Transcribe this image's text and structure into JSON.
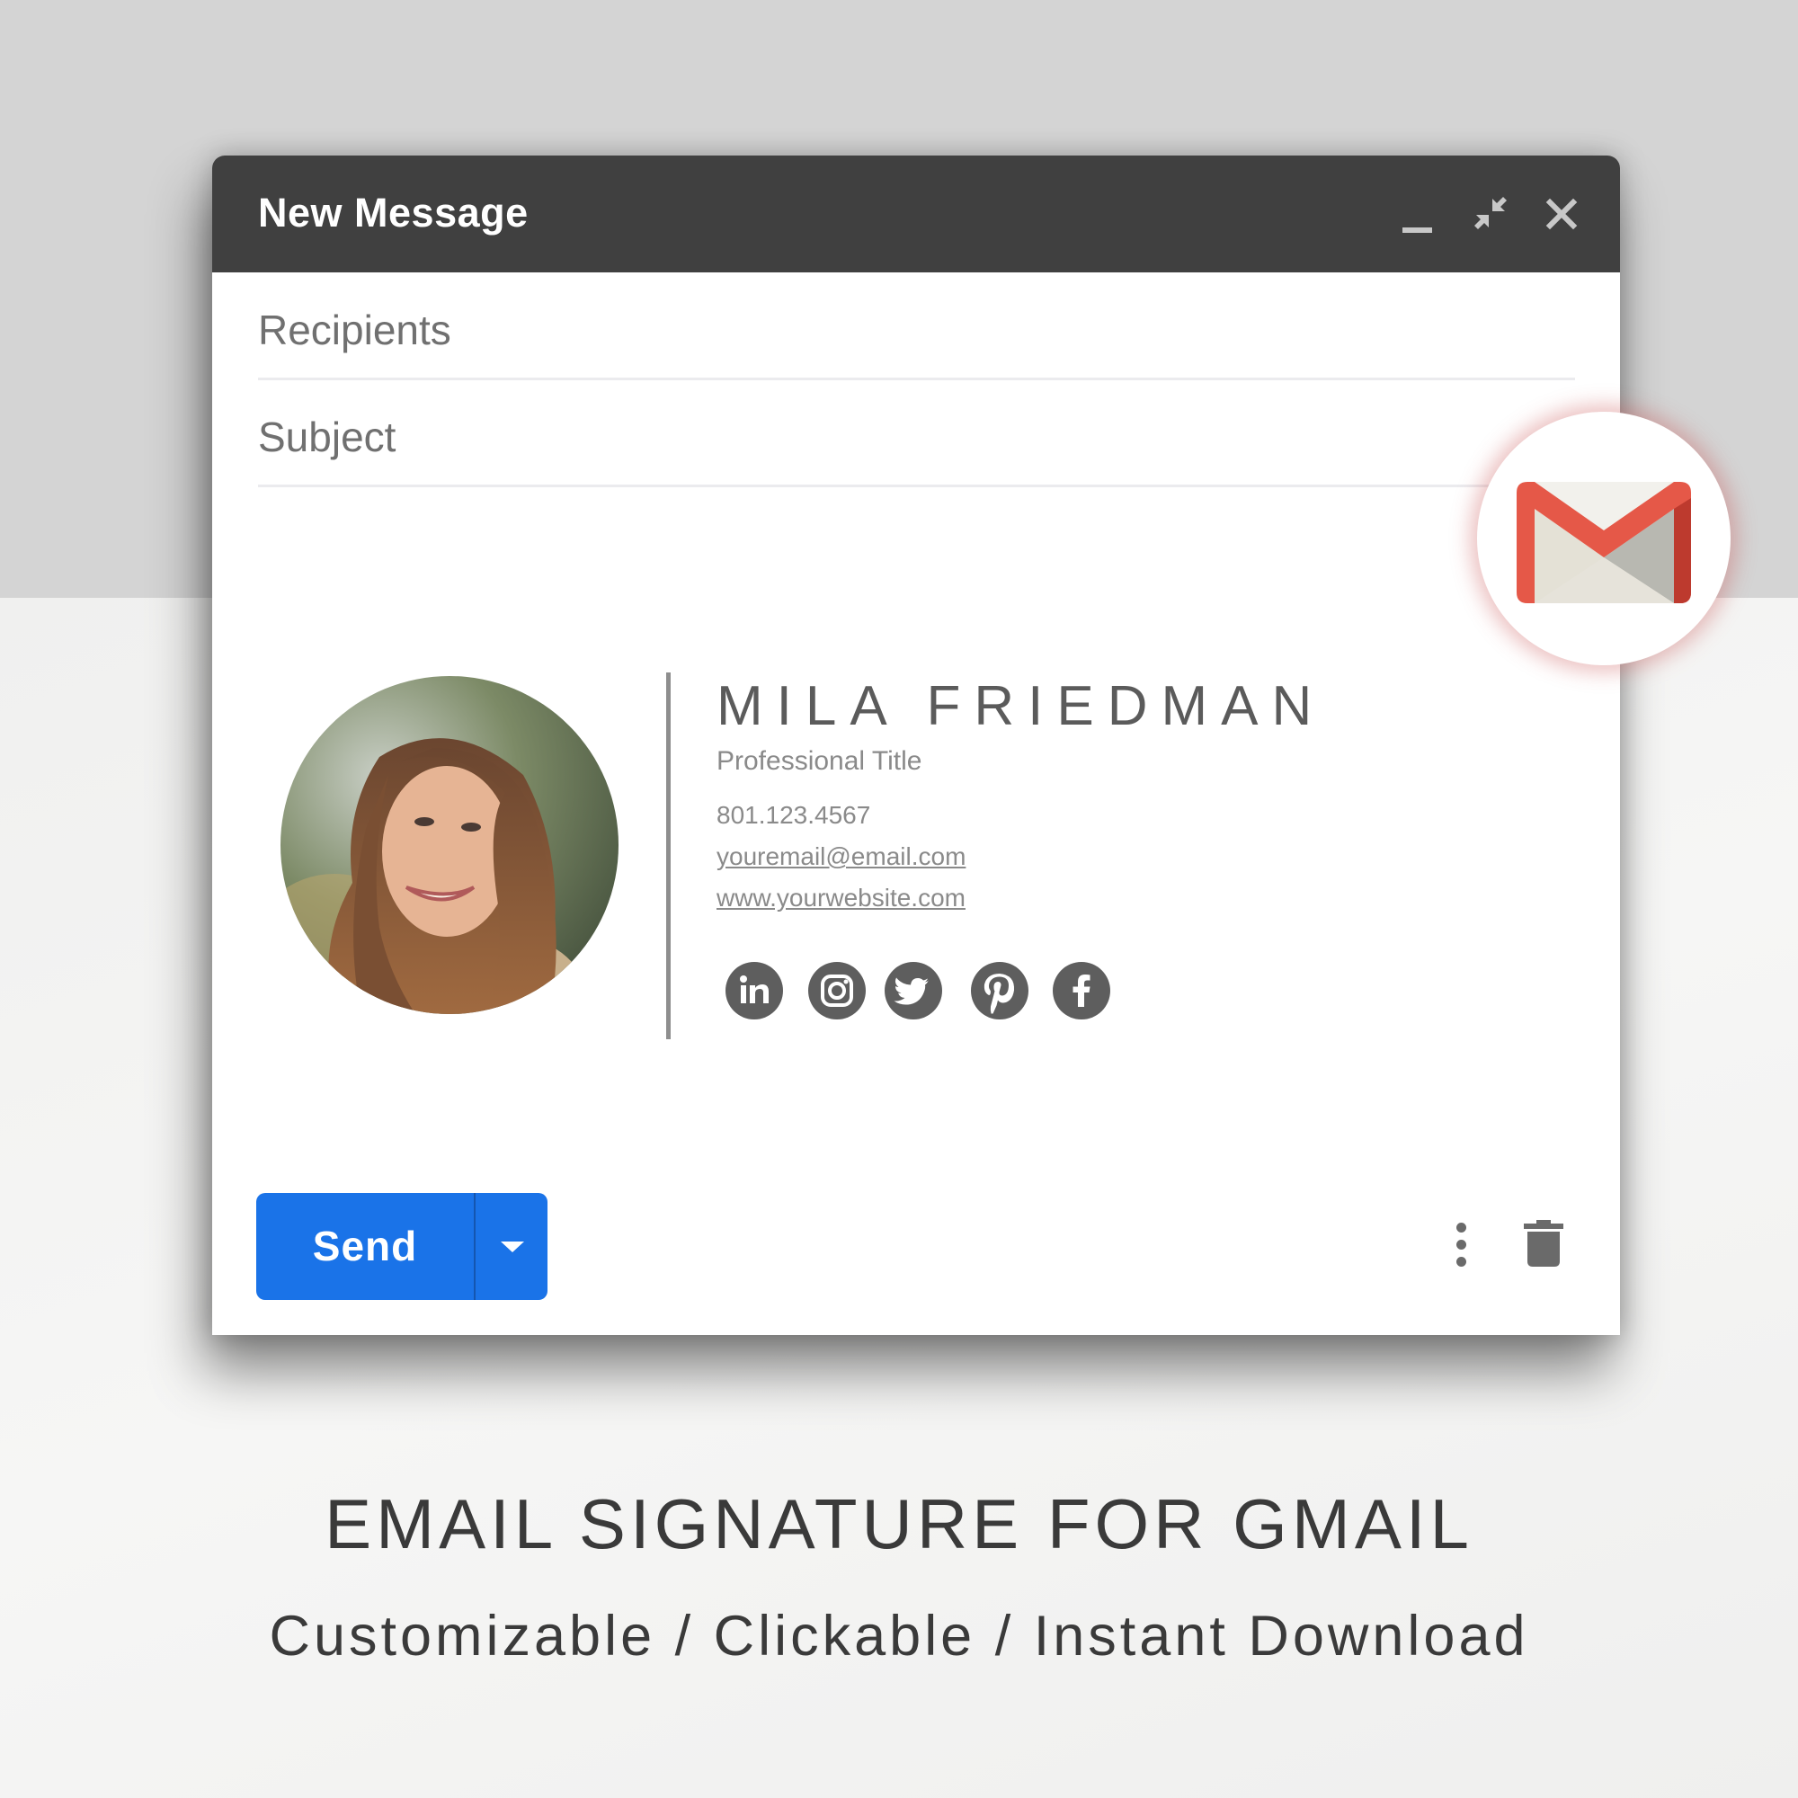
{
  "background": {
    "top_color": "#d4d4d4",
    "bottom_color": "#f2f2f1"
  },
  "compose": {
    "title": "New Message",
    "window_controls": [
      {
        "name": "minimize",
        "icon": "minimize-icon"
      },
      {
        "name": "exit-full-screen",
        "icon": "exit-fullscreen-icon"
      },
      {
        "name": "close",
        "icon": "close-icon"
      }
    ],
    "recipients": {
      "label": "Recipients",
      "value": ""
    },
    "subject": {
      "label": "Subject",
      "value": ""
    },
    "signature": {
      "name": "MILA FRIEDMAN",
      "title": "Professional Title",
      "phone": "801.123.4567",
      "email": "youremail@email.com",
      "website": "www.yourwebsite.com",
      "social": [
        {
          "network": "linkedin",
          "icon": "linkedin-icon"
        },
        {
          "network": "instagram",
          "icon": "instagram-icon"
        },
        {
          "network": "twitter",
          "icon": "twitter-icon"
        },
        {
          "network": "pinterest",
          "icon": "pinterest-icon"
        },
        {
          "network": "facebook",
          "icon": "facebook-icon"
        }
      ]
    },
    "footer": {
      "send_label": "Send",
      "send_color": "#1a73e8",
      "more_send_options": "chevron-down-icon",
      "more_options": "more-vert-icon",
      "discard": "trash-icon"
    }
  },
  "badge": {
    "brand": "Gmail",
    "icon": "gmail-logo-icon",
    "accent": "#e55848"
  },
  "marketing": {
    "headline": "EMAIL SIGNATURE FOR GMAIL",
    "subline": "Customizable / Clickable / Instant Download"
  }
}
